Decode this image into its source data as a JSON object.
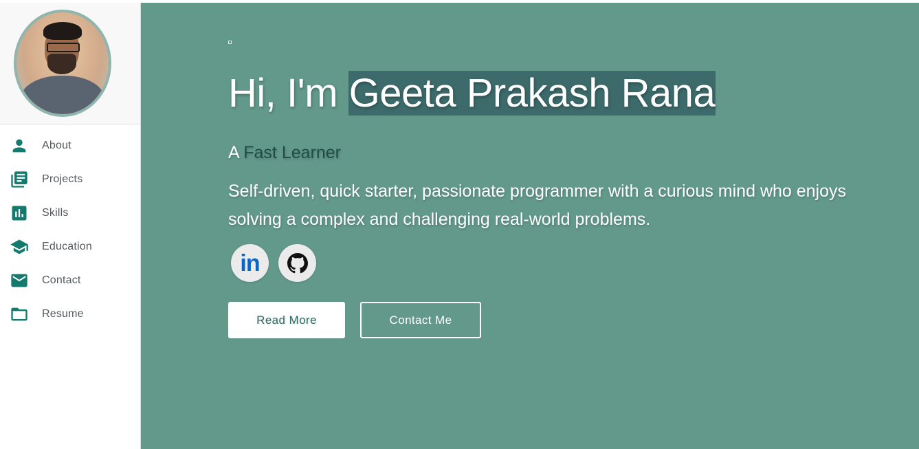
{
  "sidebar": {
    "items": [
      {
        "label": "About",
        "icon": "person-icon"
      },
      {
        "label": "Projects",
        "icon": "newspaper-icon"
      },
      {
        "label": "Skills",
        "icon": "bar-chart-icon"
      },
      {
        "label": "Education",
        "icon": "graduation-cap-icon"
      },
      {
        "label": "Contact",
        "icon": "mail-icon"
      },
      {
        "label": "Resume",
        "icon": "folder-icon"
      }
    ]
  },
  "hero": {
    "greeting_prefix": "Hi, I'm ",
    "name": "Geeta Prakash Rana",
    "tagline_prefix": "A ",
    "tagline_accent": "Fast Learner",
    "bio": "Self-driven, quick starter, passionate programmer with a curious mind who enjoys solving a complex and challenging real-world problems.",
    "socials": [
      {
        "label": "in",
        "icon": "linkedin-icon"
      },
      {
        "label": "",
        "icon": "github-icon"
      }
    ],
    "buttons": {
      "read_more": "Read More",
      "contact_me": "Contact Me"
    }
  },
  "colors": {
    "hero_bg": "#63998b",
    "accent": "#147a6e",
    "name_highlight": "#3d6b6b",
    "tagline_accent": "#1f4d45"
  }
}
